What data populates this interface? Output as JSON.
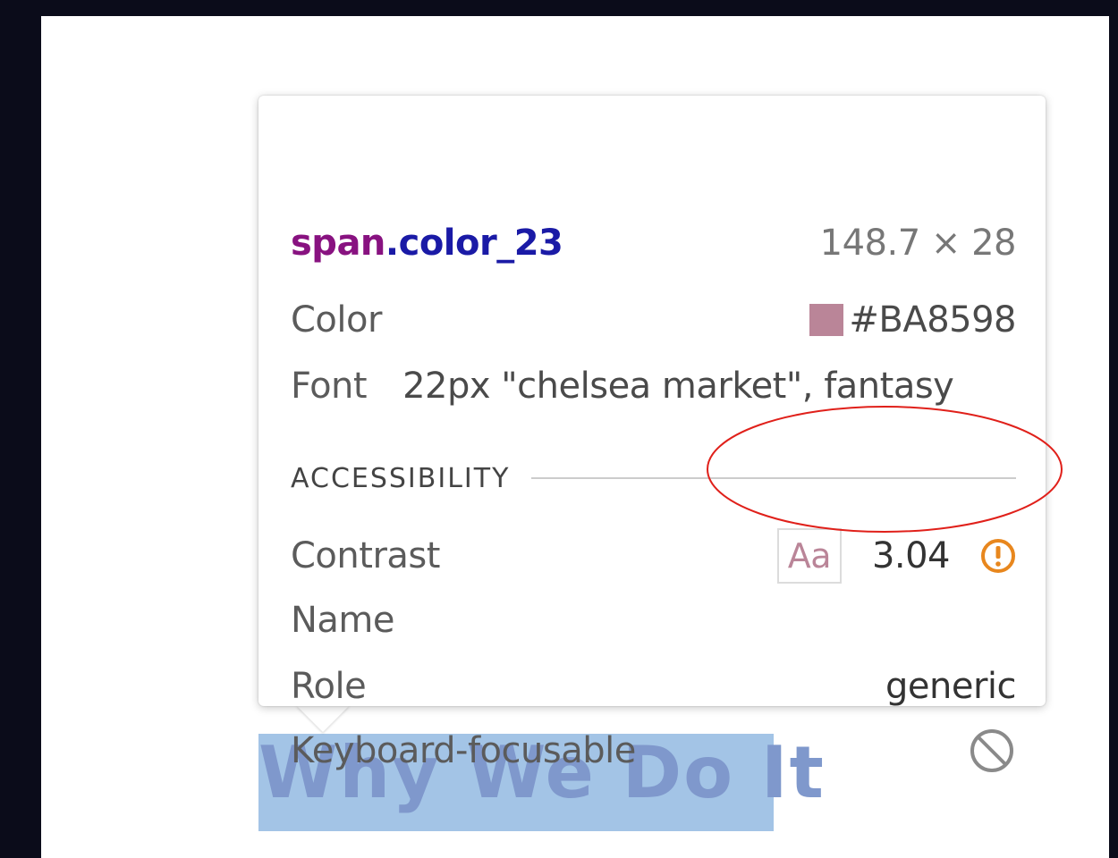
{
  "tooltip": {
    "selector_tag": "span",
    "selector_class": ".color_23",
    "dimensions": "148.7 × 28",
    "color_label": "Color",
    "color_value": "#BA8598",
    "font_label": "Font",
    "font_value": "22px \"chelsea market\", fantasy",
    "section_title": "ACCESSIBILITY",
    "contrast_label": "Contrast",
    "contrast_sample": "Aa",
    "contrast_value": "3.04",
    "contrast_status_icon": "warning-icon",
    "name_label": "Name",
    "role_label": "Role",
    "role_value": "generic",
    "keyboard_label": "Keyboard-focusable",
    "keyboard_icon": "not-allowed-icon"
  },
  "page": {
    "heading": "Why We Do It"
  },
  "colors": {
    "swatch": "#BA8598",
    "highlight": "#a3c4e6",
    "annotation": "#e0201a",
    "warning": "#e8871e"
  }
}
